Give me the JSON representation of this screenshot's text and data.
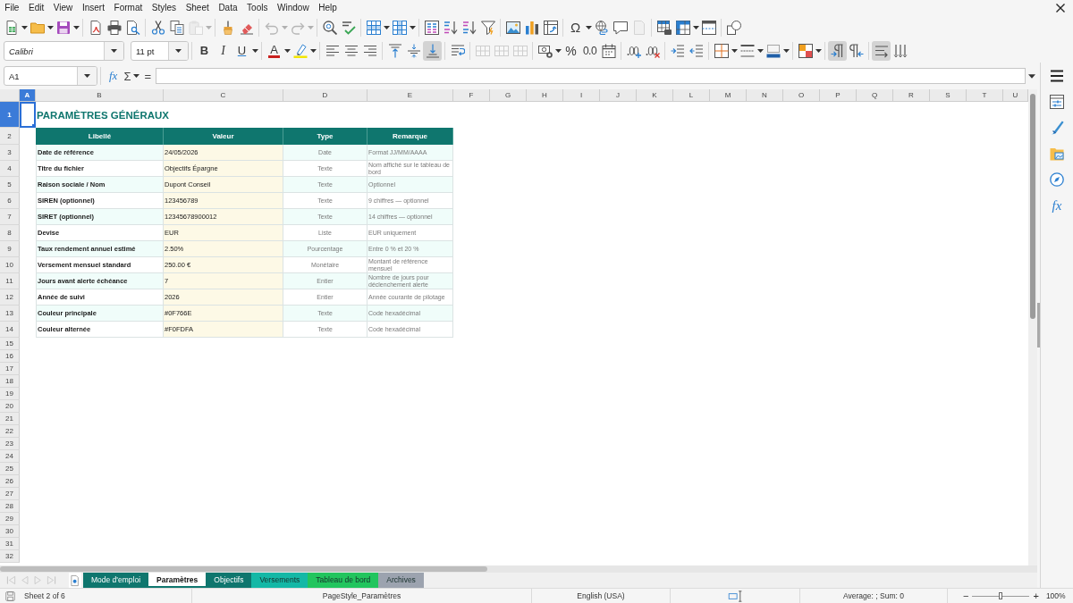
{
  "menu": {
    "items": [
      "File",
      "Edit",
      "View",
      "Insert",
      "Format",
      "Styles",
      "Sheet",
      "Data",
      "Tools",
      "Window",
      "Help"
    ]
  },
  "toolbars": {
    "standard": [
      [
        {
          "dropdown": true,
          "disabled": false
        },
        {
          "dropdown": true,
          "disabled": false
        },
        {
          "dropdown": true,
          "disabled": false
        }
      ],
      [
        {
          "dropdown": false,
          "disabled": false
        },
        {
          "dropdown": false,
          "disabled": false
        },
        {
          "dropdown": false,
          "disabled": false
        }
      ],
      [
        {
          "dropdown": false,
          "disabled": false
        },
        {
          "dropdown": false,
          "disabled": false
        },
        {
          "dropdown": true,
          "disabled": true
        }
      ],
      [
        {
          "dropdown": false,
          "disabled": false
        },
        {
          "dropdown": false,
          "disabled": false
        }
      ],
      [
        {
          "dropdown": true,
          "disabled": true
        },
        {
          "dropdown": true,
          "disabled": true
        }
      ],
      [
        {
          "dropdown": false,
          "disabled": false
        },
        {
          "dropdown": false,
          "disabled": false
        }
      ],
      [
        {
          "dropdown": true,
          "disabled": false
        },
        {
          "dropdown": true,
          "disabled": false
        }
      ],
      [
        {
          "dropdown": false,
          "disabled": false
        },
        {
          "dropdown": false,
          "disabled": false
        },
        {
          "dropdown": false,
          "disabled": false
        },
        {
          "dropdown": false,
          "disabled": false
        }
      ],
      [
        {
          "dropdown": false,
          "disabled": false
        },
        {
          "dropdown": false,
          "disabled": false
        },
        {
          "dropdown": false,
          "disabled": false
        }
      ],
      [
        {
          "label": "Ω",
          "dropdown": true,
          "disabled": false
        },
        {
          "dropdown": false,
          "disabled": false
        },
        {
          "dropdown": false,
          "disabled": false
        },
        {
          "dropdown": false,
          "disabled": true
        }
      ],
      [
        {
          "dropdown": false,
          "disabled": false
        },
        {
          "dropdown": true,
          "disabled": false
        },
        {
          "dropdown": false,
          "disabled": false
        }
      ],
      [
        {
          "dropdown": false,
          "disabled": false
        }
      ]
    ],
    "formatting": [
      [
        {
          "label": "B",
          "dropdown": false,
          "disabled": false,
          "pressed": false
        },
        {
          "label": "I",
          "dropdown": false,
          "disabled": false,
          "pressed": false
        },
        {
          "label": "U",
          "dropdown": true,
          "disabled": false,
          "pressed": false
        }
      ],
      [
        {
          "label": "A",
          "dropdown": true,
          "disabled": false,
          "pressed": false
        },
        {
          "dropdown": true,
          "disabled": false,
          "pressed": false
        }
      ],
      [
        {
          "dropdown": false,
          "disabled": false,
          "pressed": false
        },
        {
          "dropdown": false,
          "disabled": false,
          "pressed": false
        },
        {
          "dropdown": false,
          "disabled": false,
          "pressed": false
        }
      ],
      [
        {
          "dropdown": false,
          "disabled": false,
          "pressed": false
        },
        {
          "dropdown": false,
          "disabled": false,
          "pressed": false
        },
        {
          "dropdown": false,
          "disabled": false,
          "pressed": true
        }
      ],
      [
        {
          "dropdown": false,
          "disabled": false,
          "pressed": false
        }
      ],
      [
        {
          "dropdown": false,
          "disabled": true,
          "pressed": false
        },
        {
          "dropdown": false,
          "disabled": true,
          "pressed": false
        },
        {
          "dropdown": false,
          "disabled": true,
          "pressed": false
        }
      ],
      [
        {
          "dropdown": true,
          "disabled": false,
          "pressed": false
        },
        {
          "label": "%",
          "dropdown": false,
          "disabled": false,
          "pressed": false
        },
        {
          "label": "0.0",
          "dropdown": false,
          "disabled": false,
          "pressed": false
        },
        {
          "dropdown": false,
          "disabled": false,
          "pressed": false
        }
      ],
      [
        {
          "dropdown": false,
          "disabled": false,
          "pressed": false
        },
        {
          "dropdown": false,
          "disabled": false,
          "pressed": false
        }
      ],
      [
        {
          "dropdown": false,
          "disabled": false,
          "pressed": false
        },
        {
          "dropdown": false,
          "disabled": false,
          "pressed": false
        }
      ],
      [
        {
          "dropdown": true,
          "disabled": false,
          "pressed": false
        },
        {
          "dropdown": true,
          "disabled": false,
          "pressed": false
        },
        {
          "dropdown": true,
          "disabled": false,
          "pressed": false
        }
      ],
      [
        {
          "dropdown": true,
          "disabled": false,
          "pressed": false
        }
      ],
      [
        {
          "dropdown": false,
          "disabled": false,
          "pressed": true
        },
        {
          "dropdown": false,
          "disabled": false,
          "pressed": false
        }
      ],
      [
        {
          "dropdown": false,
          "disabled": false,
          "pressed": true
        },
        {
          "dropdown": false,
          "disabled": false,
          "pressed": false
        }
      ]
    ]
  },
  "font_name": {
    "value": "Calibri"
  },
  "font_size": {
    "value": "11 pt"
  },
  "formula_bar": {
    "cell_reference": "A1",
    "function_wizard": "fx",
    "sum": "Σ",
    "formula": "="
  },
  "sheet": {
    "column_headers": [
      {
        "label": "A",
        "selected": true
      },
      {
        "label": "B",
        "selected": false
      },
      {
        "label": "C",
        "selected": false
      },
      {
        "label": "D",
        "selected": false
      },
      {
        "label": "E",
        "selected": false
      },
      {
        "label": "F",
        "selected": false
      },
      {
        "label": "G",
        "selected": false
      },
      {
        "label": "H",
        "selected": false
      },
      {
        "label": "I",
        "selected": false
      },
      {
        "label": "J",
        "selected": false
      },
      {
        "label": "K",
        "selected": false
      },
      {
        "label": "L",
        "selected": false
      },
      {
        "label": "M",
        "selected": false
      },
      {
        "label": "N",
        "selected": false
      },
      {
        "label": "O",
        "selected": false
      },
      {
        "label": "P",
        "selected": false
      },
      {
        "label": "Q",
        "selected": false
      },
      {
        "label": "R",
        "selected": false
      },
      {
        "label": "S",
        "selected": false
      },
      {
        "label": "T",
        "selected": false
      },
      {
        "label": "U",
        "selected": false
      }
    ],
    "row_headers": [
      {
        "label": "1",
        "selected": true
      },
      {
        "label": "2",
        "selected": false
      },
      {
        "label": "3",
        "selected": false
      },
      {
        "label": "4",
        "selected": false
      },
      {
        "label": "5",
        "selected": false
      },
      {
        "label": "6",
        "selected": false
      },
      {
        "label": "7",
        "selected": false
      },
      {
        "label": "8",
        "selected": false
      },
      {
        "label": "9",
        "selected": false
      },
      {
        "label": "10",
        "selected": false
      },
      {
        "label": "11",
        "selected": false
      },
      {
        "label": "12",
        "selected": false
      },
      {
        "label": "13",
        "selected": false
      },
      {
        "label": "14",
        "selected": false
      },
      {
        "label": "15",
        "selected": false
      },
      {
        "label": "16",
        "selected": false
      },
      {
        "label": "17",
        "selected": false
      },
      {
        "label": "18",
        "selected": false
      },
      {
        "label": "19",
        "selected": false
      },
      {
        "label": "20",
        "selected": false
      },
      {
        "label": "21",
        "selected": false
      },
      {
        "label": "22",
        "selected": false
      },
      {
        "label": "23",
        "selected": false
      },
      {
        "label": "24",
        "selected": false
      },
      {
        "label": "25",
        "selected": false
      },
      {
        "label": "26",
        "selected": false
      },
      {
        "label": "27",
        "selected": false
      },
      {
        "label": "28",
        "selected": false
      },
      {
        "label": "29",
        "selected": false
      },
      {
        "label": "30",
        "selected": false
      },
      {
        "label": "31",
        "selected": false
      },
      {
        "label": "32",
        "selected": false
      }
    ],
    "title": "PARAMÈTRES GÉNÉRAUX",
    "table": {
      "columns": [
        "Libellé",
        "Valeur",
        "Type",
        "Remarque"
      ],
      "rows": [
        {
          "label": "Date de référence",
          "value": "24/05/2026",
          "type": "Date",
          "remark": "Format JJ/MM/AAAA"
        },
        {
          "label": "Titre du fichier",
          "value": "Objectifs Épargne",
          "type": "Texte",
          "remark": "Nom affiché sur le tableau de bord"
        },
        {
          "label": "Raison sociale / Nom",
          "value": "Dupont Conseil",
          "type": "Texte",
          "remark": "Optionnel"
        },
        {
          "label": "SIREN (optionnel)",
          "value": "123456789",
          "type": "Texte",
          "remark": "9 chiffres — optionnel"
        },
        {
          "label": "SIRET (optionnel)",
          "value": "12345678900012",
          "type": "Texte",
          "remark": "14 chiffres — optionnel"
        },
        {
          "label": "Devise",
          "value": "EUR",
          "type": "Liste",
          "remark": "EUR uniquement"
        },
        {
          "label": "Taux rendement annuel estimé",
          "value": "2.50%",
          "type": "Pourcentage",
          "remark": "Entre 0 % et 20 %"
        },
        {
          "label": "Versement mensuel standard",
          "value": "250.00 €",
          "type": "Monétaire",
          "remark": "Montant de référence mensuel"
        },
        {
          "label": "Jours avant alerte échéance",
          "value": "7",
          "type": "Entier",
          "remark": "Nombre de jours pour déclenchement alerte"
        },
        {
          "label": "Année de suivi",
          "value": "2026",
          "type": "Entier",
          "remark": "Année courante de pilotage"
        },
        {
          "label": "Couleur principale",
          "value": "#0F766E",
          "type": "Texte",
          "remark": "Code hexadécimal"
        },
        {
          "label": "Couleur alternée",
          "value": "#F0FDFA",
          "type": "Texte",
          "remark": "Code hexadécimal"
        }
      ]
    }
  },
  "sidebar": {
    "functions": "fx"
  },
  "sheet_tabs": {
    "navigation_disabled": true,
    "tabs": [
      {
        "label": "Mode d'emploi",
        "color": "#0F766E",
        "selected": false
      },
      {
        "label": "Paramètres",
        "color": "#0F766E",
        "selected": true
      },
      {
        "label": "Objectifs",
        "color": "#0F766E",
        "selected": false
      },
      {
        "label": "Versements",
        "color": "#14B8A6",
        "selected": false
      },
      {
        "label": "Tableau de bord",
        "color": "#22C55E",
        "selected": false
      },
      {
        "label": "Archives",
        "color": "#9CA3AF",
        "selected": false
      }
    ]
  },
  "status_bar": {
    "sheet_info": "Sheet 2 of 6",
    "page_style": "PageStyle_Paramètres",
    "language": "English (USA)",
    "selection_summary": "Average: ; Sum: 0",
    "zoom_out": "−",
    "zoom_in": "+",
    "zoom": {
      "level": 0.5
    },
    "zoom_percent": "100%"
  }
}
